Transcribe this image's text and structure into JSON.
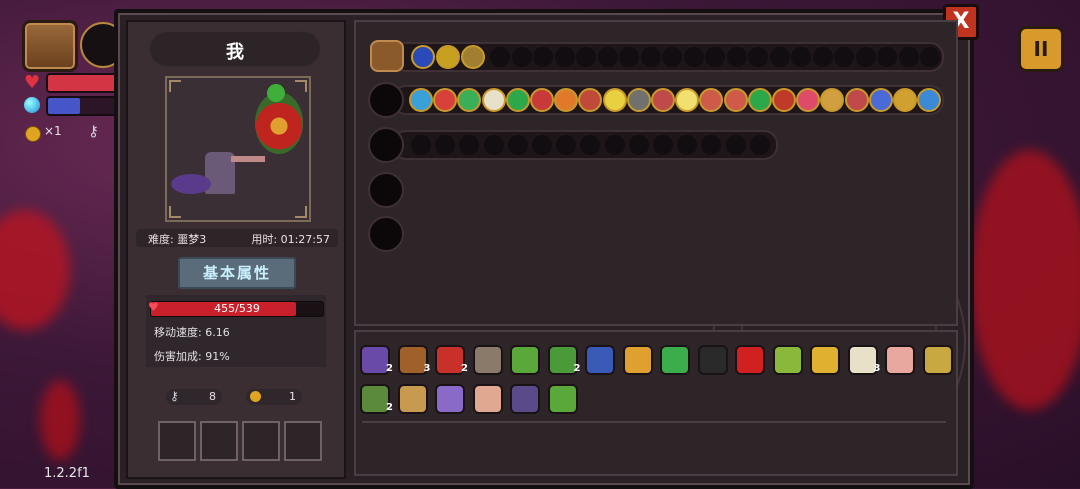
{
  "hud": {
    "coin_count": "×1",
    "version": "1.2.2f1",
    "pause_label": "II"
  },
  "panel": {
    "close_label": "X",
    "player_name": "我",
    "difficulty": "难度: 噩梦3",
    "time": "用时: 01:27:57",
    "stats_title": "基本属性",
    "hp_text": "455/539",
    "hp_fraction": 0.844,
    "move_speed": "移动速度: 6.16",
    "damage_bonus": "伤害加成: 91%",
    "keys": "8",
    "coins": "1"
  },
  "colors": {
    "accent_gold": "#c89a2a",
    "hp_red": "#c9202c",
    "close_red": "#c0331f"
  },
  "icons": {
    "weapons": [
      "chest-icon",
      "staff-icon",
      "wand-icon",
      "empty-slot",
      "empty-slot"
    ],
    "row1_items": [
      "blue-arrow-icon",
      "gold-lattice-icon",
      "gold-ring-icon"
    ],
    "row2_items": [
      "blue-bubble-icon",
      "red-spark-icon",
      "green-orb-icon",
      "egg-icon",
      "green-swirl-icon",
      "red-goblet-icon",
      "orange-splat-icon",
      "red-sack-icon",
      "white-star-icon",
      "rock-icon",
      "red-pot-icon",
      "sparkle-icon",
      "red-meat-icon",
      "red-meat-icon",
      "green-swirl-icon",
      "red-claw-icon",
      "pink-eye-icon",
      "clock-icon",
      "red-pot-icon",
      "blue-star-icon",
      "gold-cross-icon",
      "blue-arrow-icon"
    ],
    "bottom_row1": [
      {
        "name": "witch-head-icon",
        "count": "2"
      },
      {
        "name": "log-icon",
        "count": "3"
      },
      {
        "name": "demon-mask-icon",
        "count": "2"
      },
      {
        "name": "skull-bowl-icon",
        "count": ""
      },
      {
        "name": "green-slime-icon",
        "count": ""
      },
      {
        "name": "snake-icon",
        "count": "2"
      },
      {
        "name": "blue-scroll-icon",
        "count": ""
      },
      {
        "name": "gold-talisman-icon",
        "count": ""
      },
      {
        "name": "clover-icon",
        "count": ""
      },
      {
        "name": "tombstone-icon",
        "count": ""
      },
      {
        "name": "red-eye-icon",
        "count": ""
      },
      {
        "name": "green-horn-icon",
        "count": ""
      },
      {
        "name": "gold-crown-icon",
        "count": ""
      },
      {
        "name": "fang-icon",
        "count": "3"
      },
      {
        "name": "pink-fish-icon",
        "count": ""
      },
      {
        "name": "gem-ring-icon",
        "count": ""
      }
    ],
    "bottom_row2": [
      {
        "name": "green-shell-icon",
        "count": "2"
      },
      {
        "name": "amulet-icon",
        "count": ""
      },
      {
        "name": "feather-pen-icon",
        "count": ""
      },
      {
        "name": "meat-pie-icon",
        "count": ""
      },
      {
        "name": "purple-bag-icon",
        "count": ""
      },
      {
        "name": "sprout-icon",
        "count": ""
      }
    ]
  }
}
